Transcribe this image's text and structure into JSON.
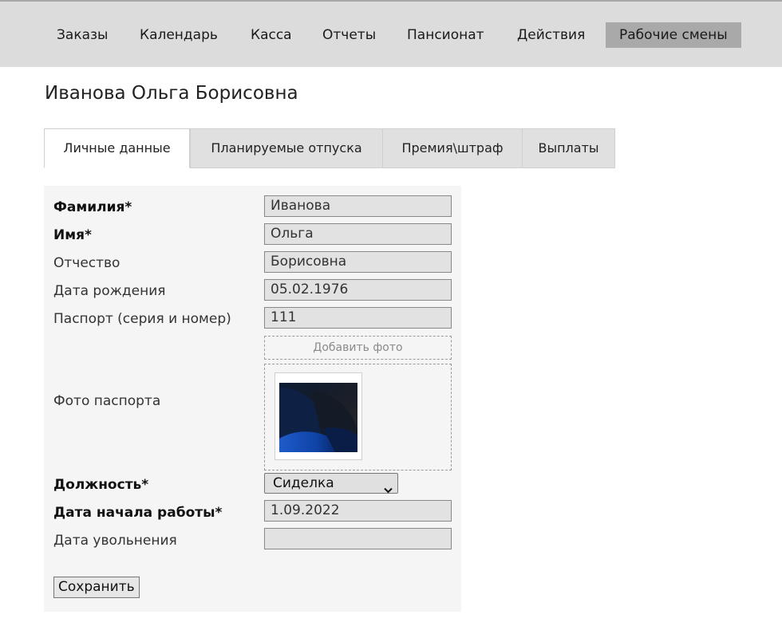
{
  "nav": {
    "items": [
      {
        "label": "Заказы"
      },
      {
        "label": "Календарь"
      },
      {
        "label": "Касса"
      },
      {
        "label": "Отчеты"
      },
      {
        "label": "Пансионат"
      },
      {
        "label": "Действия"
      },
      {
        "label": "Рабочие смены",
        "active": true
      }
    ]
  },
  "page": {
    "title": "Иванова Ольга Борисовна"
  },
  "tabs": [
    {
      "label": "Личные данные",
      "active": true
    },
    {
      "label": "Планируемые отпуска"
    },
    {
      "label": "Премия\\штраф"
    },
    {
      "label": "Выплаты"
    }
  ],
  "form": {
    "last_name": {
      "label": "Фамилия*",
      "value": "Иванова"
    },
    "first_name": {
      "label": "Имя*",
      "value": "Ольга"
    },
    "patronymic": {
      "label": "Отчество",
      "value": "Борисовна"
    },
    "birth_date": {
      "label": "Дата рождения",
      "value": "05.02.1976"
    },
    "passport": {
      "label": "Паспорт (серия и номер)",
      "value": "111"
    },
    "add_photo_label": "Добавить фото",
    "passport_photo": {
      "label": "Фото паспорта"
    },
    "position": {
      "label": "Должность*",
      "value": "Сиделка"
    },
    "start_date": {
      "label": "Дата начала работы*",
      "value": "1.09.2022"
    },
    "end_date": {
      "label": "Дата увольнения",
      "value": ""
    },
    "save_label": "Сохранить"
  }
}
